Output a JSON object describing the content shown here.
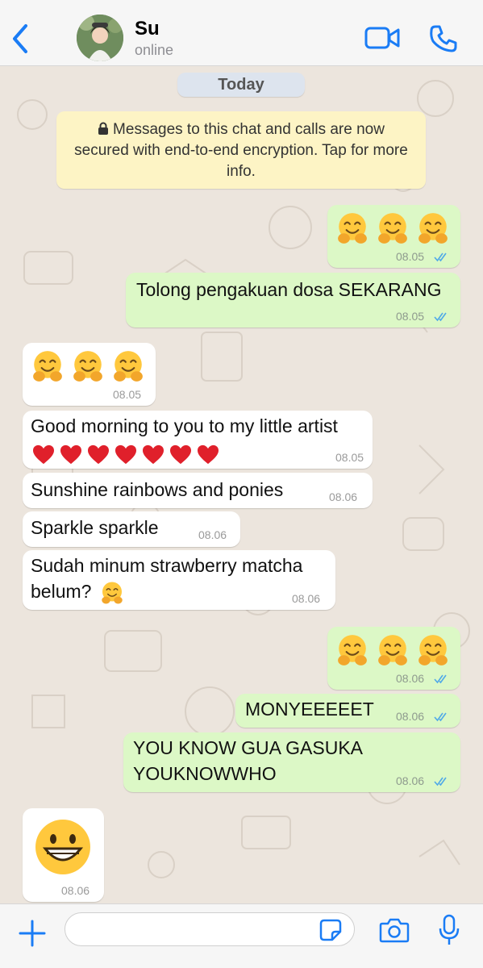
{
  "header": {
    "contact_name": "Su",
    "status": "online"
  },
  "chat": {
    "date_label": "Today",
    "encryption_notice": "Messages to this chat and calls are now secured with end-to-end encryption. Tap for more info.",
    "messages": [
      {
        "direction": "outgoing",
        "content": "🤗🤗🤗",
        "time": "08.05",
        "status": "read"
      },
      {
        "direction": "outgoing",
        "text": "Tolong pengakuan dosa SEKARANG",
        "time": "08.05",
        "status": "read"
      },
      {
        "direction": "incoming",
        "content": "🤗🤗🤗",
        "time": "08.05"
      },
      {
        "direction": "incoming",
        "line1": "Good morning to you to my little artist",
        "line2": "❤️❤️❤️❤️❤️❤️❤️",
        "time": "08.05"
      },
      {
        "direction": "incoming",
        "text": "Sunshine rainbows and ponies",
        "time": "08.06"
      },
      {
        "direction": "incoming",
        "text": "Sparkle sparkle",
        "time": "08.06"
      },
      {
        "direction": "incoming",
        "line1": "Sudah minum strawberry matcha",
        "line2": "belum?",
        "line2_emoji": "🤗",
        "time": "08.06"
      },
      {
        "direction": "outgoing",
        "content": "🤗🤗🤗",
        "time": "08.06",
        "status": "read"
      },
      {
        "direction": "outgoing",
        "text": "MONYEEEEET",
        "time": "08.06",
        "status": "read"
      },
      {
        "direction": "outgoing",
        "line1": "YOU KNOW GUA GASUKA",
        "line2": "YOUKNOWWHO",
        "time": "08.06",
        "status": "read"
      },
      {
        "direction": "incoming",
        "content": "😁",
        "time": "08.06"
      }
    ]
  },
  "composer": {
    "input_value": "",
    "icons": [
      "plus-icon",
      "sticker-icon",
      "camera-icon",
      "microphone-icon"
    ]
  },
  "colors": {
    "accent": "#1a7cf5",
    "outgoing_bubble": "#dcf8c6",
    "incoming_bubble": "#ffffff",
    "chat_background": "#ece5dd",
    "notice_background": "#fdf4c5",
    "read_ticks": "#4fa9e8"
  }
}
